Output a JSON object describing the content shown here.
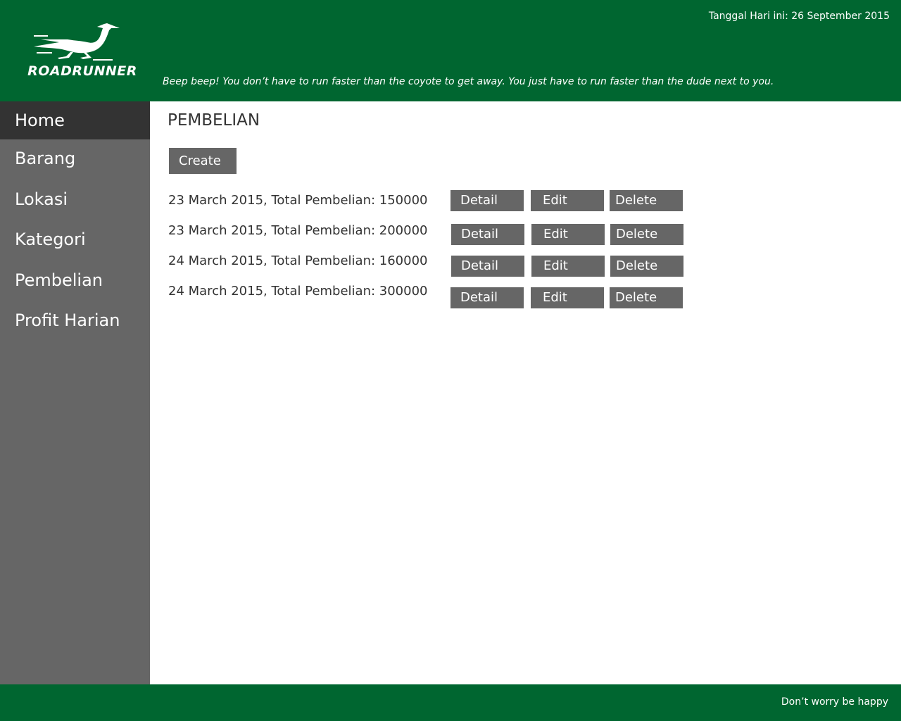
{
  "header": {
    "logo_text": "ROADRUNNER",
    "date_text": "Tanggal Hari ini: 26 September 2015",
    "tagline": "Beep beep! You don’t have to run faster than the coyote to get away. You just have to run faster than the dude next to you.",
    "bg_color": "#006630"
  },
  "sidebar": {
    "items": [
      {
        "label": "Home",
        "active": true
      },
      {
        "label": "Barang"
      },
      {
        "label": "Lokasi"
      },
      {
        "label": "Kategori"
      },
      {
        "label": "Pembelian"
      },
      {
        "label": "Profit Harian"
      }
    ]
  },
  "main": {
    "title": "PEMBELIAN",
    "create_label": "Create",
    "rows": [
      {
        "text": "23 March 2015, Total Pembelian: 150000",
        "detail": "Detail",
        "edit": "Edit",
        "delete": "Delete"
      },
      {
        "text": "23 March 2015, Total Pembelian: 200000",
        "detail": "Detail",
        "edit": "Edit",
        "delete": "Delete"
      },
      {
        "text": "24 March 2015, Total Pembelian: 160000",
        "detail": "Detail",
        "edit": "Edit",
        "delete": "Delete"
      },
      {
        "text": "24 March 2015, Total Pembelian: 300000",
        "detail": "Detail",
        "edit": "Edit",
        "delete": "Delete"
      }
    ]
  },
  "footer": {
    "text": "Don’t worry be happy"
  }
}
